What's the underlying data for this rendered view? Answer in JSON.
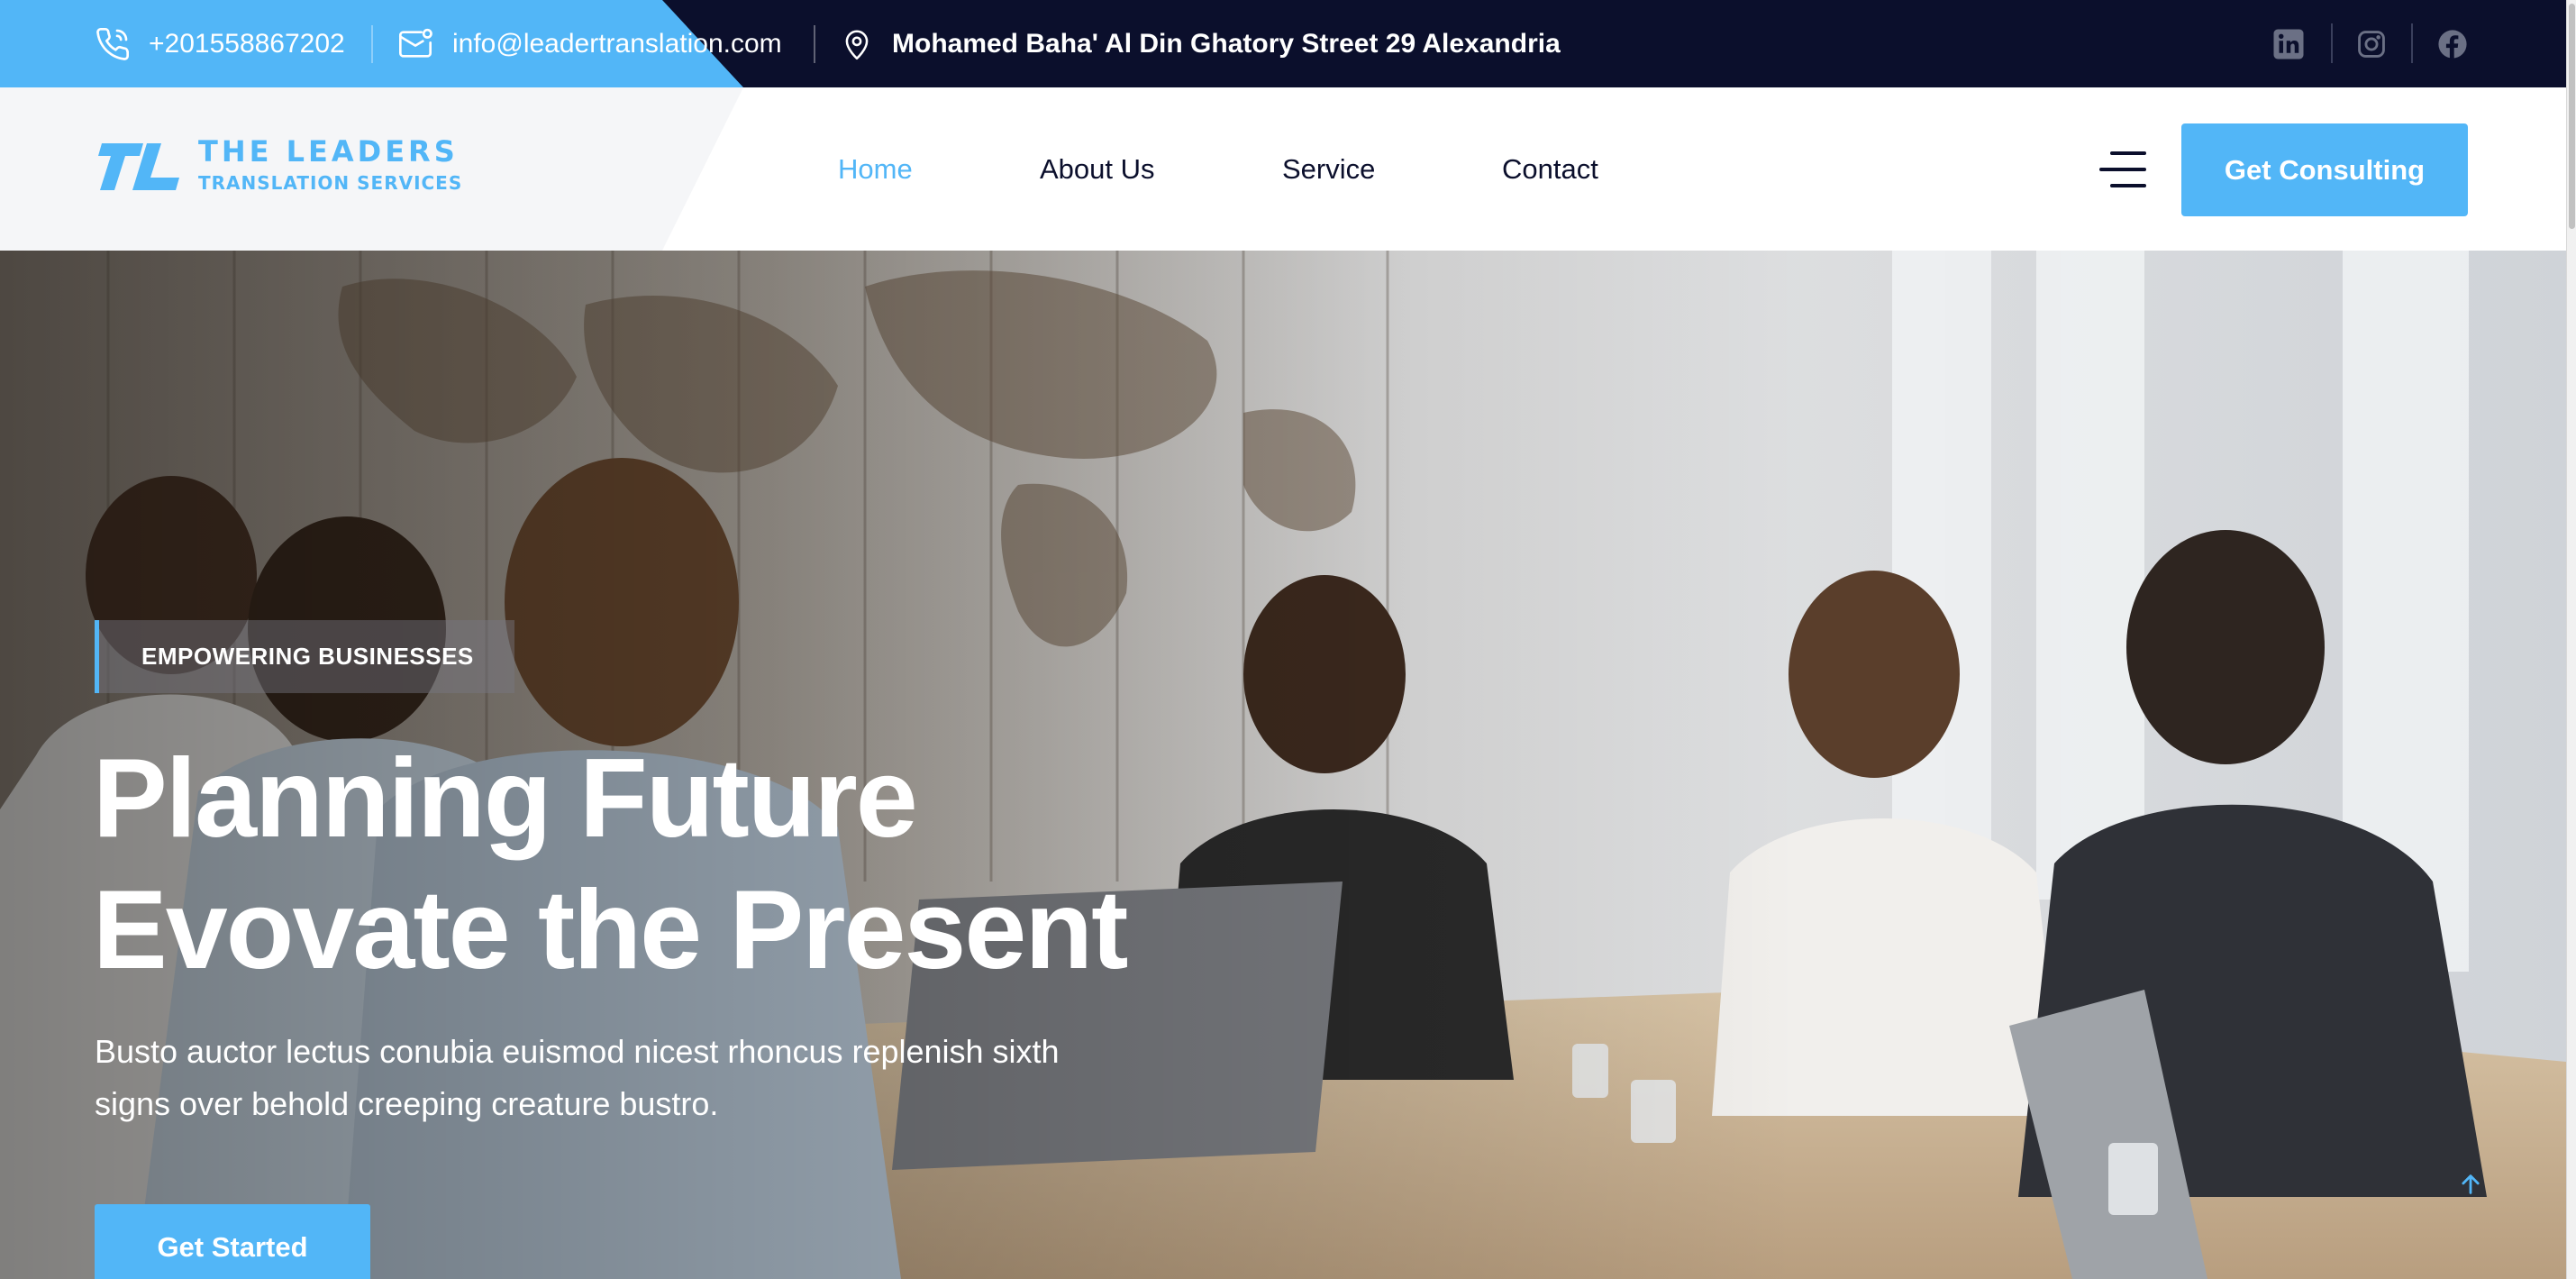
{
  "topbar": {
    "phone": "+201558867202",
    "email": "info@leadertranslation.com",
    "address": "Mohamed Baha' Al Din Ghatory Street 29 Alexandria",
    "social": [
      {
        "icon": "linkedin-icon"
      },
      {
        "icon": "instagram-icon"
      },
      {
        "icon": "facebook-icon"
      }
    ]
  },
  "logo": {
    "name": "THE LEADERS",
    "sub": "TRANSLATION SERVICES"
  },
  "nav": {
    "items": [
      {
        "label": "Home",
        "active": true
      },
      {
        "label": "About Us",
        "active": false
      },
      {
        "label": "Service",
        "active": false
      },
      {
        "label": "Contact",
        "active": false
      }
    ],
    "cta": "Get Consulting"
  },
  "hero": {
    "badge": "EMPOWERING BUSINESSES",
    "title_line1": "Planning Future",
    "title_line2": "Evovate the Present",
    "description_line1": "Busto auctor lectus conubia euismod nicest rhoncus replenish sixth",
    "description_line2": "signs over behold creeping creature bustro.",
    "cta": "Get Started"
  },
  "colors": {
    "accent": "#52b6f7",
    "dark": "#0b0f2c",
    "white": "#ffffff"
  }
}
